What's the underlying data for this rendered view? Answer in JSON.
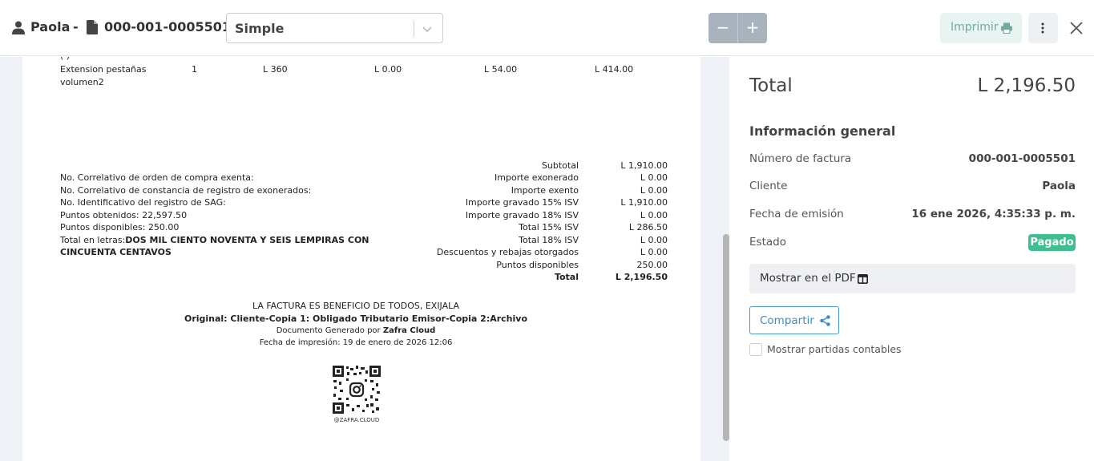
{
  "header": {
    "client_name": "Paola",
    "dash": "-",
    "invoice_number": "000-001-0005501",
    "template_select": "Simple",
    "zoom_out": "−",
    "zoom_in": "+",
    "print_label": "Imprimir"
  },
  "invoice": {
    "partial_row_top": "(                  )",
    "row": {
      "description_line1": "Extension pestañas",
      "description_line2": "volumen2",
      "quantity": "1",
      "price": "L 360",
      "discount": "L 0.00",
      "tax": "L 54.00",
      "total": "L 414.00"
    },
    "left_info": [
      "No. Correlativo de orden de compra exenta:",
      "No. Correlativo de constancia de registro de exonerados:",
      "No. Identificativo del registro de SAG:",
      "Puntos obtenidos: 22,597.50",
      "Puntos disponibles: 250.00"
    ],
    "total_letters_prefix": "Total en letras:",
    "total_letters_line1": "DOS MIL CIENTO NOVENTA Y SEIS LEMPIRAS CON",
    "total_letters_line2": "CINCUENTA CENTAVOS",
    "summary": [
      {
        "label": "Subtotal",
        "value": "L 1,910.00"
      },
      {
        "label": "Importe exonerado",
        "value": "L 0.00"
      },
      {
        "label": "Importe exento",
        "value": "L 0.00"
      },
      {
        "label": "Importe gravado 15% ISV",
        "value": "L 1,910.00"
      },
      {
        "label": "Importe gravado 18% ISV",
        "value": "L 0.00"
      },
      {
        "label": "Total 15% ISV",
        "value": "L 286.50"
      },
      {
        "label": "Total 18% ISV",
        "value": "L 0.00"
      },
      {
        "label": "Descuentos y rebajas otorgados",
        "value": "L 0.00"
      },
      {
        "label": "Puntos disponibles",
        "value": "250.00"
      },
      {
        "label": "Total",
        "value": "L 2,196.50"
      }
    ],
    "footer_line1": "LA FACTURA ES BENEFICIO DE TODOS, EXIJALA",
    "footer_line2": "Original: Cliente-Copia 1: Obligado Tributario Emisor-Copia 2:Archivo",
    "footer_line3_prefix": "Documento Generado por",
    "footer_line3_brand": "Zafra Cloud",
    "footer_line4": "Fecha de impresión: 19 de enero de 2026 12:06",
    "qr_caption": "@ZAFRA.CLOUD"
  },
  "sidebar": {
    "total_label": "Total",
    "total_value": "L 2,196.50",
    "section_title": "Información general",
    "fields": [
      {
        "label": "Número de factura",
        "value": "000-001-0005501"
      },
      {
        "label": "Cliente",
        "value": "Paola"
      },
      {
        "label": "Fecha de emisión",
        "value": "16 ene 2026, 4:35:33 p. m."
      },
      {
        "label": "Estado",
        "value": ""
      }
    ],
    "status_badge": "Pagado",
    "pdf_toggle_label": "Mostrar en el PDF",
    "share_label": "Compartir",
    "checkbox_label": "Mostrar partidas contables"
  },
  "colors": {
    "badge": "#3fbf8f",
    "share": "#3d8cc9",
    "print_bg": "#e7f4f1",
    "zoom_bg": "#a9b3bd"
  }
}
